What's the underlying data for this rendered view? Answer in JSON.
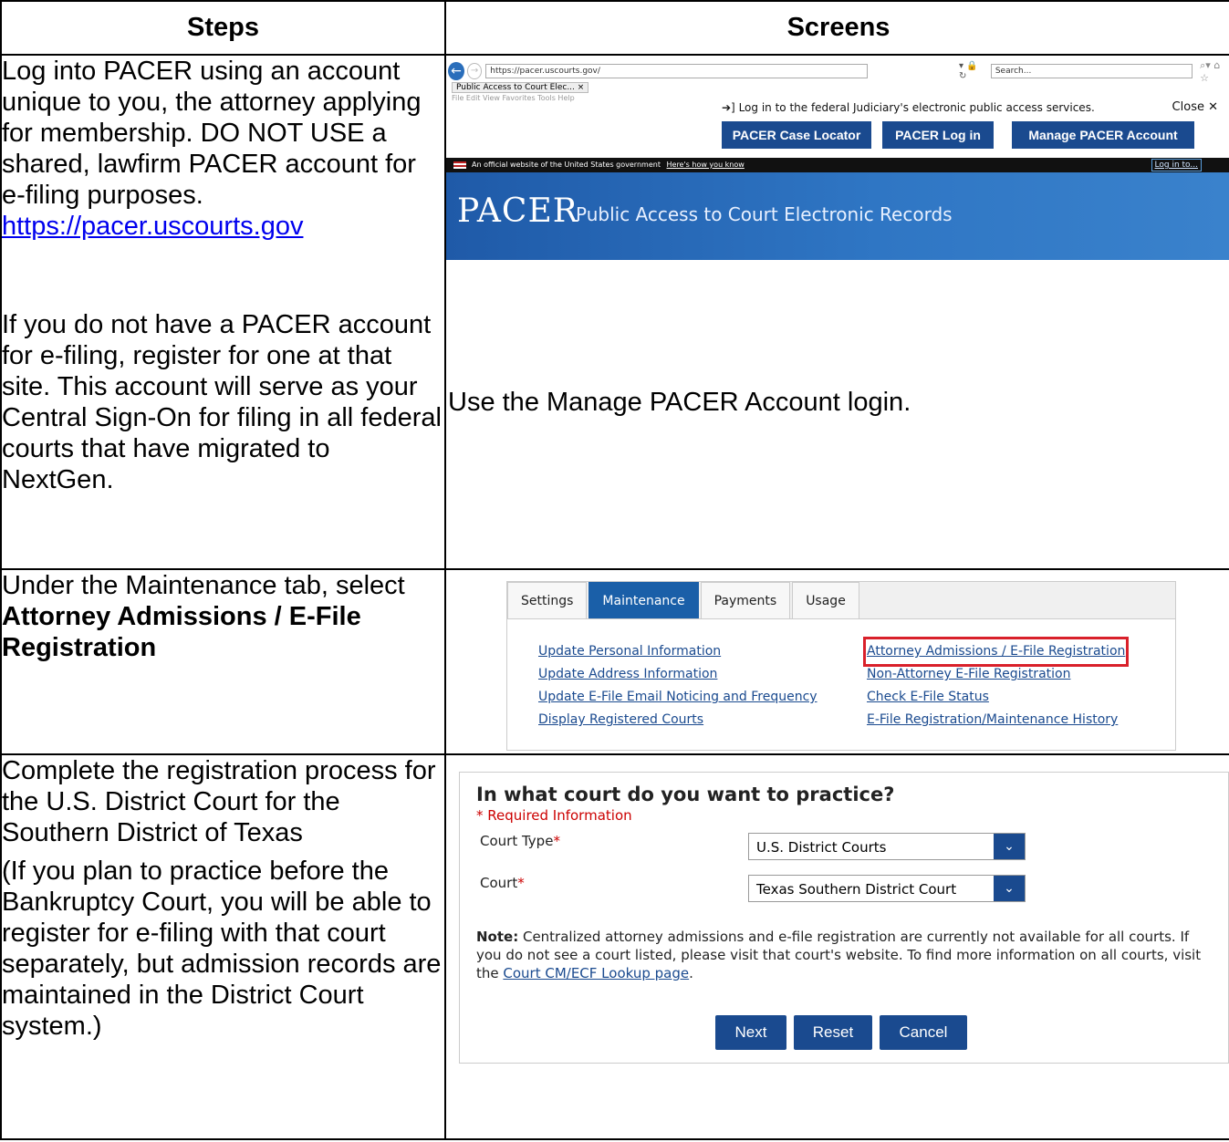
{
  "header": {
    "steps": "Steps",
    "screens": "Screens"
  },
  "row1": {
    "p1": "Log into PACER using an account unique to you, the attorney applying for membership. DO NOT USE a shared, lawfirm PACER account for e-filing purposes.",
    "link": "https://pacer.uscourts.gov",
    "p2": "If you do not have a PACER account for e-filing, register for one at that site. This account will serve as your Central Sign-On for filing in all federal courts that have migrated to NextGen.",
    "screen_note": "Use the Manage PACER Account login.",
    "browser": {
      "url": "https://pacer.uscourts.gov/",
      "search_placeholder": "Search...",
      "tab_title": "Public Access to Court Elec... ×",
      "menu": "File  Edit  View  Favorites  Tools  Help",
      "notice": "Log in to the federal Judiciary's electronic public access services.",
      "close": "Close ✕",
      "btn_locator": "PACER Case Locator",
      "btn_login": "PACER Log in",
      "btn_manage": "Manage PACER Account",
      "gov_text": "An official website of the United States government",
      "gov_link": "Here's how you know",
      "gov_login": "Log in to...",
      "logo": "PACER",
      "tagline": "Public Access to Court Electronic Records"
    }
  },
  "row2": {
    "text_plain": "Under the Maintenance tab, select ",
    "text_bold": "Attorney Admissions / E-File Registration",
    "tabs": [
      "Settings",
      "Maintenance",
      "Payments",
      "Usage"
    ],
    "left_links": [
      "Update Personal Information",
      "Update Address Information",
      "Update E-File Email Noticing and Frequency",
      "Display Registered Courts"
    ],
    "right_links": [
      "Attorney Admissions / E-File Registration",
      "Non-Attorney E-File Registration",
      "Check E-File Status",
      "E-File Registration/Maintenance History"
    ]
  },
  "row3": {
    "p1": "Complete the registration process for the U.S. District Court for the Southern District of Texas",
    "p2": "(If you plan to practice before the Bankruptcy Court, you will be able to register for e-filing with that court separately, but admission records are maintained in the District Court system.)",
    "form": {
      "title": "In what court do you want to practice?",
      "required": "* Required Information",
      "court_type_label": "Court Type",
      "court_type_value": "U.S. District Courts",
      "court_label": "Court",
      "court_value": "Texas Southern District Court",
      "note_bold": "Note:",
      "note_text": " Centralized attorney admissions and e-file registration are currently not available for all courts. If you do not see a court listed, please visit that court's website. To find more information on all courts, visit the ",
      "note_link": "Court CM/ECF Lookup page",
      "note_end": ".",
      "btn_next": "Next",
      "btn_reset": "Reset",
      "btn_cancel": "Cancel"
    }
  }
}
